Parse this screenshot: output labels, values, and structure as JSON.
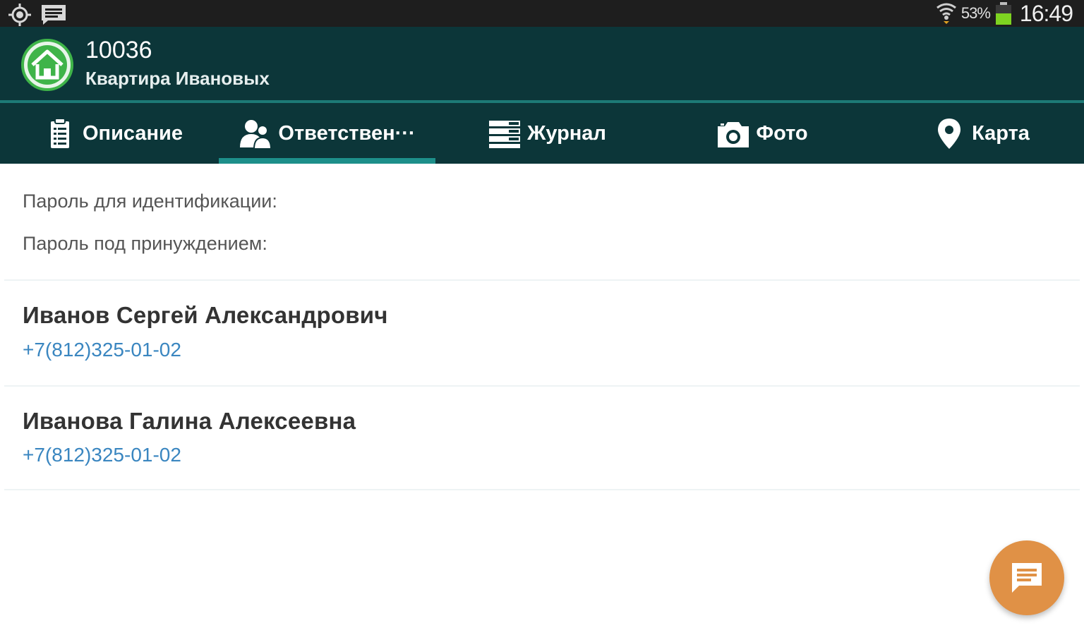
{
  "status_bar": {
    "battery_percent": "53%",
    "time": "16:49",
    "icons": [
      "gps-icon",
      "message-notification-icon",
      "wifi-icon",
      "battery-icon"
    ]
  },
  "header": {
    "object_number": "10036",
    "object_name": "Квартира Ивановых",
    "logo_icon": "home-icon"
  },
  "tabs": [
    {
      "label": "Описание",
      "icon": "clipboard-icon",
      "active": false
    },
    {
      "label": "Ответствен···",
      "icon": "people-icon",
      "active": true
    },
    {
      "label": "Журнал",
      "icon": "journal-list-icon",
      "active": false
    },
    {
      "label": "Фото",
      "icon": "camera-icon",
      "active": false
    },
    {
      "label": "Карта",
      "icon": "map-pin-icon",
      "active": false
    }
  ],
  "passwords": {
    "identification_label": "Пароль для идентификации:",
    "duress_label": "Пароль под принуждением:"
  },
  "persons": [
    {
      "name": "Иванов Сергей Александрович",
      "phone": "+7(812)325-01-02"
    },
    {
      "name": "Иванова Галина Алексеевна",
      "phone": "+7(812)325-01-02"
    }
  ],
  "fab": {
    "icon": "chat-icon"
  },
  "colors": {
    "app_bar": "#0c3639",
    "tab_indicator": "#1d8f8a",
    "phone_link": "#3a86c0",
    "fab": "#e09146",
    "logo_green": "#3fb449"
  }
}
